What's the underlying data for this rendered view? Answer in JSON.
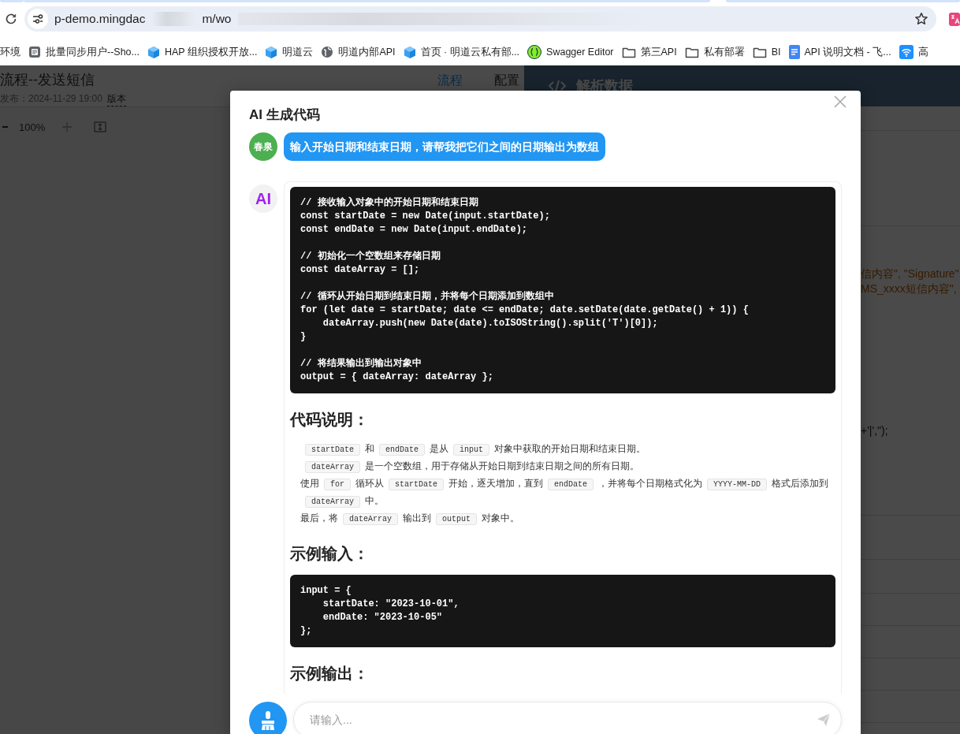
{
  "browser": {
    "url_parts": [
      "p-demo.mingdac",
      "m/wo"
    ],
    "bookmarks": [
      {
        "kind": "plain",
        "label": "环境"
      },
      {
        "kind": "doc",
        "label": "批量同步用户--Sho..."
      },
      {
        "kind": "cube",
        "label": "HAP 组织授权开放..."
      },
      {
        "kind": "cube",
        "label": "明道云"
      },
      {
        "kind": "globe",
        "label": "明道内部API"
      },
      {
        "kind": "cube",
        "label": "首页 · 明道云私有部..."
      },
      {
        "kind": "swagger",
        "label": "Swagger Editor"
      },
      {
        "kind": "folder",
        "label": "第三API"
      },
      {
        "kind": "folder",
        "label": "私有部署"
      },
      {
        "kind": "folder",
        "label": "BI"
      },
      {
        "kind": "gdoc",
        "label": "API 说明文档 - 飞..."
      },
      {
        "kind": "wifi",
        "label": "高"
      }
    ]
  },
  "app": {
    "title": "流程--发送短信",
    "published": "发布：2024-11-29 19:00",
    "version_link": "版本",
    "zoom": "100%",
    "tabs": [
      {
        "label": "流程",
        "selected": true
      },
      {
        "label": "配置",
        "selected": false
      }
    ],
    "panel": {
      "title": "解析数据",
      "code_lines": [
        "信内容\", \"Signature\"",
        "MS_xxxx短信内容\", ",
        "+'|',\");"
      ]
    }
  },
  "dialog": {
    "title": "AI 生成代码",
    "user": {
      "avatar": "春泉",
      "message": "输入开始日期和结束日期，请帮我把它们之间的日期输出为数组"
    },
    "ai": {
      "avatar": "AI",
      "blocks": [
        {
          "kind": "code",
          "text": "// 接收输入对象中的开始日期和结束日期\nconst startDate = new Date(input.startDate);\nconst endDate = new Date(input.endDate);\n\n// 初始化一个空数组来存储日期\nconst dateArray = [];\n\n// 循环从开始日期到结束日期，并将每个日期添加到数组中\nfor (let date = startDate; date <= endDate; date.setDate(date.getDate() + 1)) {\n    dateArray.push(new Date(date).toISOString().split('T')[0]);\n}\n\n// 将结果输出到输出对象中\noutput = { dateArray: dateArray };"
        },
        {
          "kind": "heading",
          "text": "代码说明："
        },
        {
          "kind": "list",
          "items": [
            [
              {
                "kind": "code",
                "text": "startDate"
              },
              {
                "kind": "text",
                "text": "和"
              },
              {
                "kind": "code",
                "text": "endDate"
              },
              {
                "kind": "text",
                "text": "是从"
              },
              {
                "kind": "code",
                "text": "input"
              },
              {
                "kind": "text",
                "text": "对象中获取的开始日期和结束日期。"
              }
            ],
            [
              {
                "kind": "code",
                "text": "dateArray"
              },
              {
                "kind": "text",
                "text": "是一个空数组，用于存储从开始日期到结束日期之间的所有日期。"
              }
            ],
            [
              {
                "kind": "text",
                "text": "使用"
              },
              {
                "kind": "code",
                "text": "for"
              },
              {
                "kind": "text",
                "text": "循环从"
              },
              {
                "kind": "code",
                "text": "startDate"
              },
              {
                "kind": "text",
                "text": "开始，逐天增加，直到"
              },
              {
                "kind": "code",
                "text": "endDate"
              },
              {
                "kind": "text",
                "text": "，并将每个日期格式化为"
              },
              {
                "kind": "code",
                "text": "YYYY-MM-DD"
              },
              {
                "kind": "text",
                "text": "格式"
              },
              {
                "kind": "text",
                "text": "后添加到"
              },
              {
                "kind": "code",
                "text": "dateArray"
              },
              {
                "kind": "text",
                "text": "中。"
              }
            ],
            [
              {
                "kind": "text",
                "text": "最后，将"
              },
              {
                "kind": "code",
                "text": "dateArray"
              },
              {
                "kind": "text",
                "text": "输出到"
              },
              {
                "kind": "code",
                "text": "output"
              },
              {
                "kind": "text",
                "text": "对象中。"
              }
            ]
          ]
        },
        {
          "kind": "heading",
          "text": "示例输入："
        },
        {
          "kind": "code",
          "text": "input = {\n    startDate: \"2023-10-01\",\n    endDate: \"2023-10-05\"\n};"
        },
        {
          "kind": "heading",
          "text": "示例输出："
        }
      ]
    },
    "input": {
      "placeholder": "请输入..."
    }
  }
}
